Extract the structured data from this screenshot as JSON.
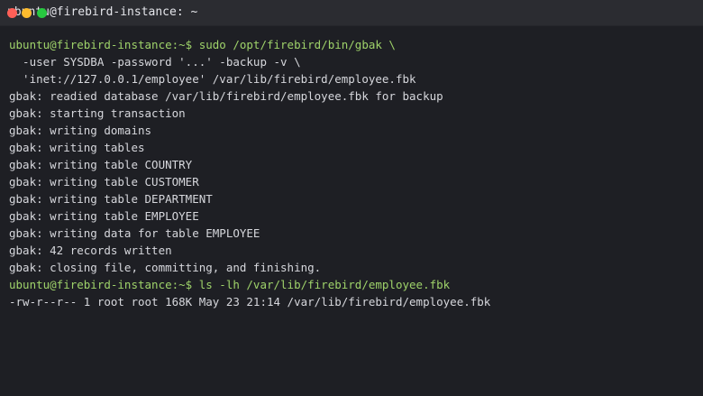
{
  "window": {
    "title": "ubuntu@firebird-instance: ~"
  },
  "terminal": {
    "lines": [
      {
        "prompt": "ubuntu@firebird-instance:~$ ",
        "text": "sudo /opt/firebird/bin/gbak \\"
      },
      {
        "text": "  -user SYSDBA -password '...' -backup -v \\"
      },
      {
        "text": "  'inet://127.0.0.1/employee' /var/lib/firebird/employee.fbk"
      },
      {
        "text": "gbak: readied database /var/lib/firebird/employee.fbk for backup"
      },
      {
        "text": "gbak: starting transaction"
      },
      {
        "text": "gbak: writing domains"
      },
      {
        "text": "gbak: writing tables"
      },
      {
        "text": "gbak: writing table COUNTRY"
      },
      {
        "text": "gbak: writing table CUSTOMER"
      },
      {
        "text": "gbak: writing table DEPARTMENT"
      },
      {
        "text": "gbak: writing table EMPLOYEE"
      },
      {
        "text": "gbak: writing data for table EMPLOYEE"
      },
      {
        "text": "gbak: 42 records written"
      },
      {
        "text": "gbak: closing file, committing, and finishing."
      },
      {
        "prompt": "ubuntu@firebird-instance:~$ ",
        "text": "ls -lh /var/lib/firebird/employee.fbk"
      },
      {
        "text": "-rw-r--r-- 1 root root 168K May 23 21:14 /var/lib/firebird/employee.fbk"
      }
    ]
  }
}
